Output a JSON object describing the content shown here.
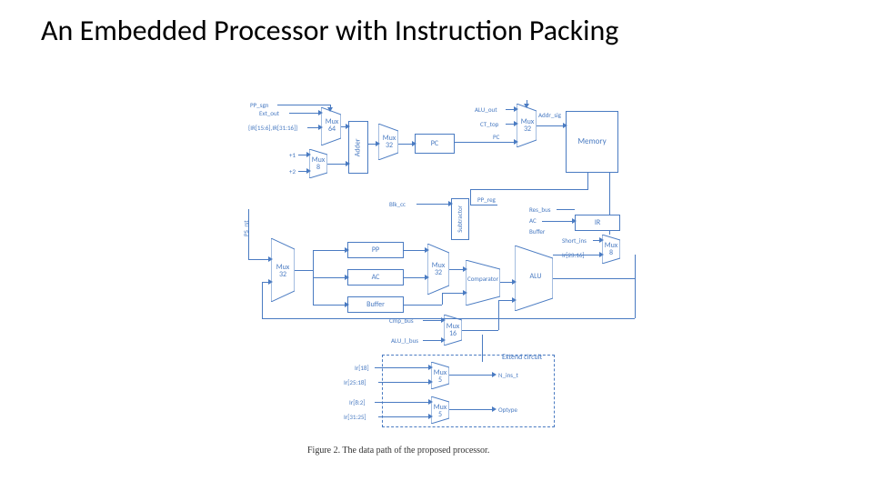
{
  "title": "An Embedded Processor with Instruction Packing",
  "caption": "Figure 2. The data path of the proposed processor.",
  "blocks": {
    "adder": "Adder",
    "pc": "PC",
    "memory": "Memory",
    "subtractor": "Subtractor",
    "pp": "PP",
    "ac": "AC",
    "buffer": "Buffer",
    "ir": "IR",
    "comparator": "Comparator",
    "extend": "Extend circuit",
    "mux_64": "Mux\n64",
    "mux_8_a": "Mux\n8",
    "mux_32_top": "Mux\n32",
    "mux_32_addr": "Mux\n32",
    "mux_32_mid": "Mux\n32",
    "mux_32_left": "Mux\n32",
    "mux_16": "Mux\n16",
    "mux_8_r": "Mux\n8",
    "mux_5_a": "Mux\n5",
    "mux_5_b": "Mux\n5",
    "alu": "ALU"
  },
  "signals": {
    "pp_sgn": "PP_sgn",
    "ext_out": "Ext_out",
    "ir_bits": "{IR[15:6],IR[31:16]}",
    "plus1": "+1",
    "plus2": "+2",
    "alu_out": "ALU_out",
    "ct_top": "CT_top",
    "pc_sig": "PC",
    "addr_sig": "Addr_sig",
    "blk_cc": "Blk_cc",
    "res_bus": "Res_bus",
    "ac_sig": "AC",
    "buffer_sig": "Buffer",
    "short_ins": "Short_ins",
    "ir_23_16": "Ir[23:16]",
    "pp_reg": "PP_reg",
    "alu_l_bus": "ALU_l_bus",
    "cmp_bus": "Cmp_bus",
    "ir_18": "Ir[18]",
    "ir_25_18": "Ir[25:18]",
    "ir_8_2": "Ir[8:2]",
    "ir_31_25": "Ir[31:25]",
    "n_ins_t": "N_ins_t",
    "optype": "Optype"
  }
}
